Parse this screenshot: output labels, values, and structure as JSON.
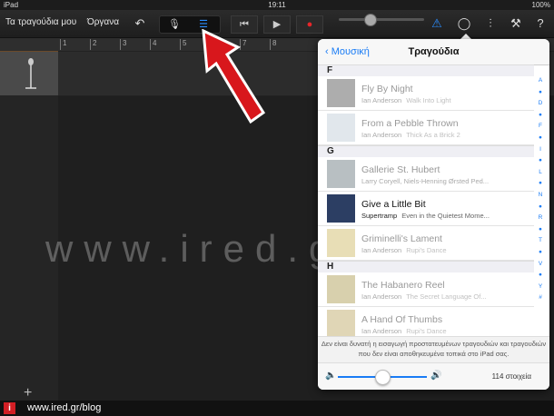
{
  "statusbar": {
    "device": "iPad",
    "time": "19:11",
    "battery": "100%"
  },
  "toolbar": {
    "my_songs": "Τα τραγούδια μου",
    "instruments": "Όργανα",
    "undo_icon": "undo-icon",
    "mic_icon": "microphone-icon",
    "tracks_icon": "tracks-view-icon",
    "rewind_icon": "rewind-icon",
    "play_icon": "play-icon",
    "record_icon": "record-icon",
    "metronome_icon": "metronome-icon",
    "loop_icon": "loop-browser-icon",
    "mixer_icon": "mixer-icon",
    "settings_icon": "wrench-icon",
    "help_icon": "help-icon",
    "accent": "#2a8dff",
    "record_color": "#e8262a"
  },
  "ruler": {
    "marks": [
      "1",
      "2",
      "3",
      "4",
      "5",
      "6",
      "7",
      "8"
    ]
  },
  "popover": {
    "back_label": "Μουσική",
    "title": "Τραγούδια",
    "sections": [
      {
        "letter": "F",
        "rows": [
          {
            "title": "Fly By Night",
            "artist": "Ian Anderson",
            "album": "Walk Into Light",
            "enabled": false
          },
          {
            "title": "From a Pebble Thrown",
            "artist": "Ian Anderson",
            "album": "Thick As a Brick 2",
            "enabled": false
          }
        ]
      },
      {
        "letter": "G",
        "rows": [
          {
            "title": "Gallerie St. Hubert",
            "artist": "Larry Coryell, Niels-Henning Ørsted Ped...",
            "album": "",
            "enabled": false
          },
          {
            "title": "Give a Little Bit",
            "artist": "Supertramp",
            "album": "Even in the Quietest Mome...",
            "enabled": true
          },
          {
            "title": "Griminelli's Lament",
            "artist": "Ian Anderson",
            "album": "Rupi's Dance",
            "enabled": false
          }
        ]
      },
      {
        "letter": "H",
        "rows": [
          {
            "title": "The Habanero Reel",
            "artist": "Ian Anderson",
            "album": "The Secret Language Of...",
            "enabled": false
          },
          {
            "title": "A Hand Of Thumbs",
            "artist": "Ian Anderson",
            "album": "Rupi's Dance",
            "enabled": false
          }
        ]
      }
    ],
    "index": [
      "A",
      "●",
      "D",
      "●",
      "F",
      "●",
      "I",
      "●",
      "L",
      "●",
      "N",
      "●",
      "R",
      "●",
      "T",
      "●",
      "V",
      "●",
      "Y",
      "#"
    ],
    "notice": "Δεν είναι δυνατή η εισαγωγή προστατευμένων τραγουδιών και τραγουδιών που δεν είναι αποθηκευμένα τοπικά στο iPad σας.",
    "count": "114 στοιχεία",
    "volume": 0.5
  },
  "watermark": "www.ired.gr/blog",
  "footer": {
    "logo": "i",
    "text": "www.ired.gr/blog"
  }
}
